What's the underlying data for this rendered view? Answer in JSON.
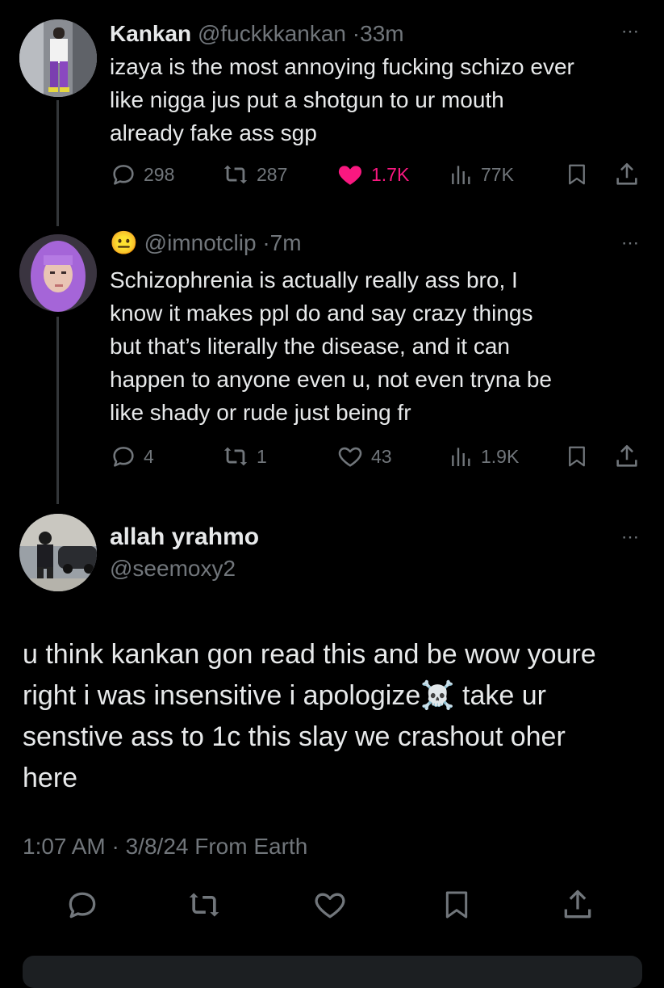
{
  "tweets": [
    {
      "name": "Kankan",
      "handle": "@fuckkkankan",
      "separator": "·",
      "time": "33m",
      "lines": [
        "izaya is the most annoying fucking schizo ever",
        "like nigga jus put a shotgun to ur mouth",
        "already fake ass sgp"
      ],
      "replies": "298",
      "reposts": "287",
      "likes": "1.7K",
      "views": "77K",
      "liked": true
    },
    {
      "name_emoji": "😐",
      "handle": "@imnotclip",
      "separator": "·",
      "time": "7m",
      "lines": [
        "Schizophrenia is actually really ass bro, I",
        "know it makes ppl do and say crazy things",
        "but that’s literally the disease, and it can",
        "happen to anyone even u, not even tryna be",
        "like shady or rude just being fr"
      ],
      "replies": "4",
      "reposts": "1",
      "likes": "43",
      "views": "1.9K",
      "liked": false
    }
  ],
  "main": {
    "name": "allah yrahmo",
    "handle": "@seemoxy2",
    "lines": [
      "u think kankan gon read this and be wow youre",
      "right i was insensitive i apologize☠️ take ur",
      "senstive ass to 1c this slay we crashout oher",
      "here"
    ],
    "timestamp": "1:07 AM · 3/8/24 From Earth"
  },
  "more_icon": "⋯",
  "colors": {
    "background": "#000000",
    "text": "#e7e9ea",
    "muted": "#71767b",
    "like_active": "#f91880"
  }
}
